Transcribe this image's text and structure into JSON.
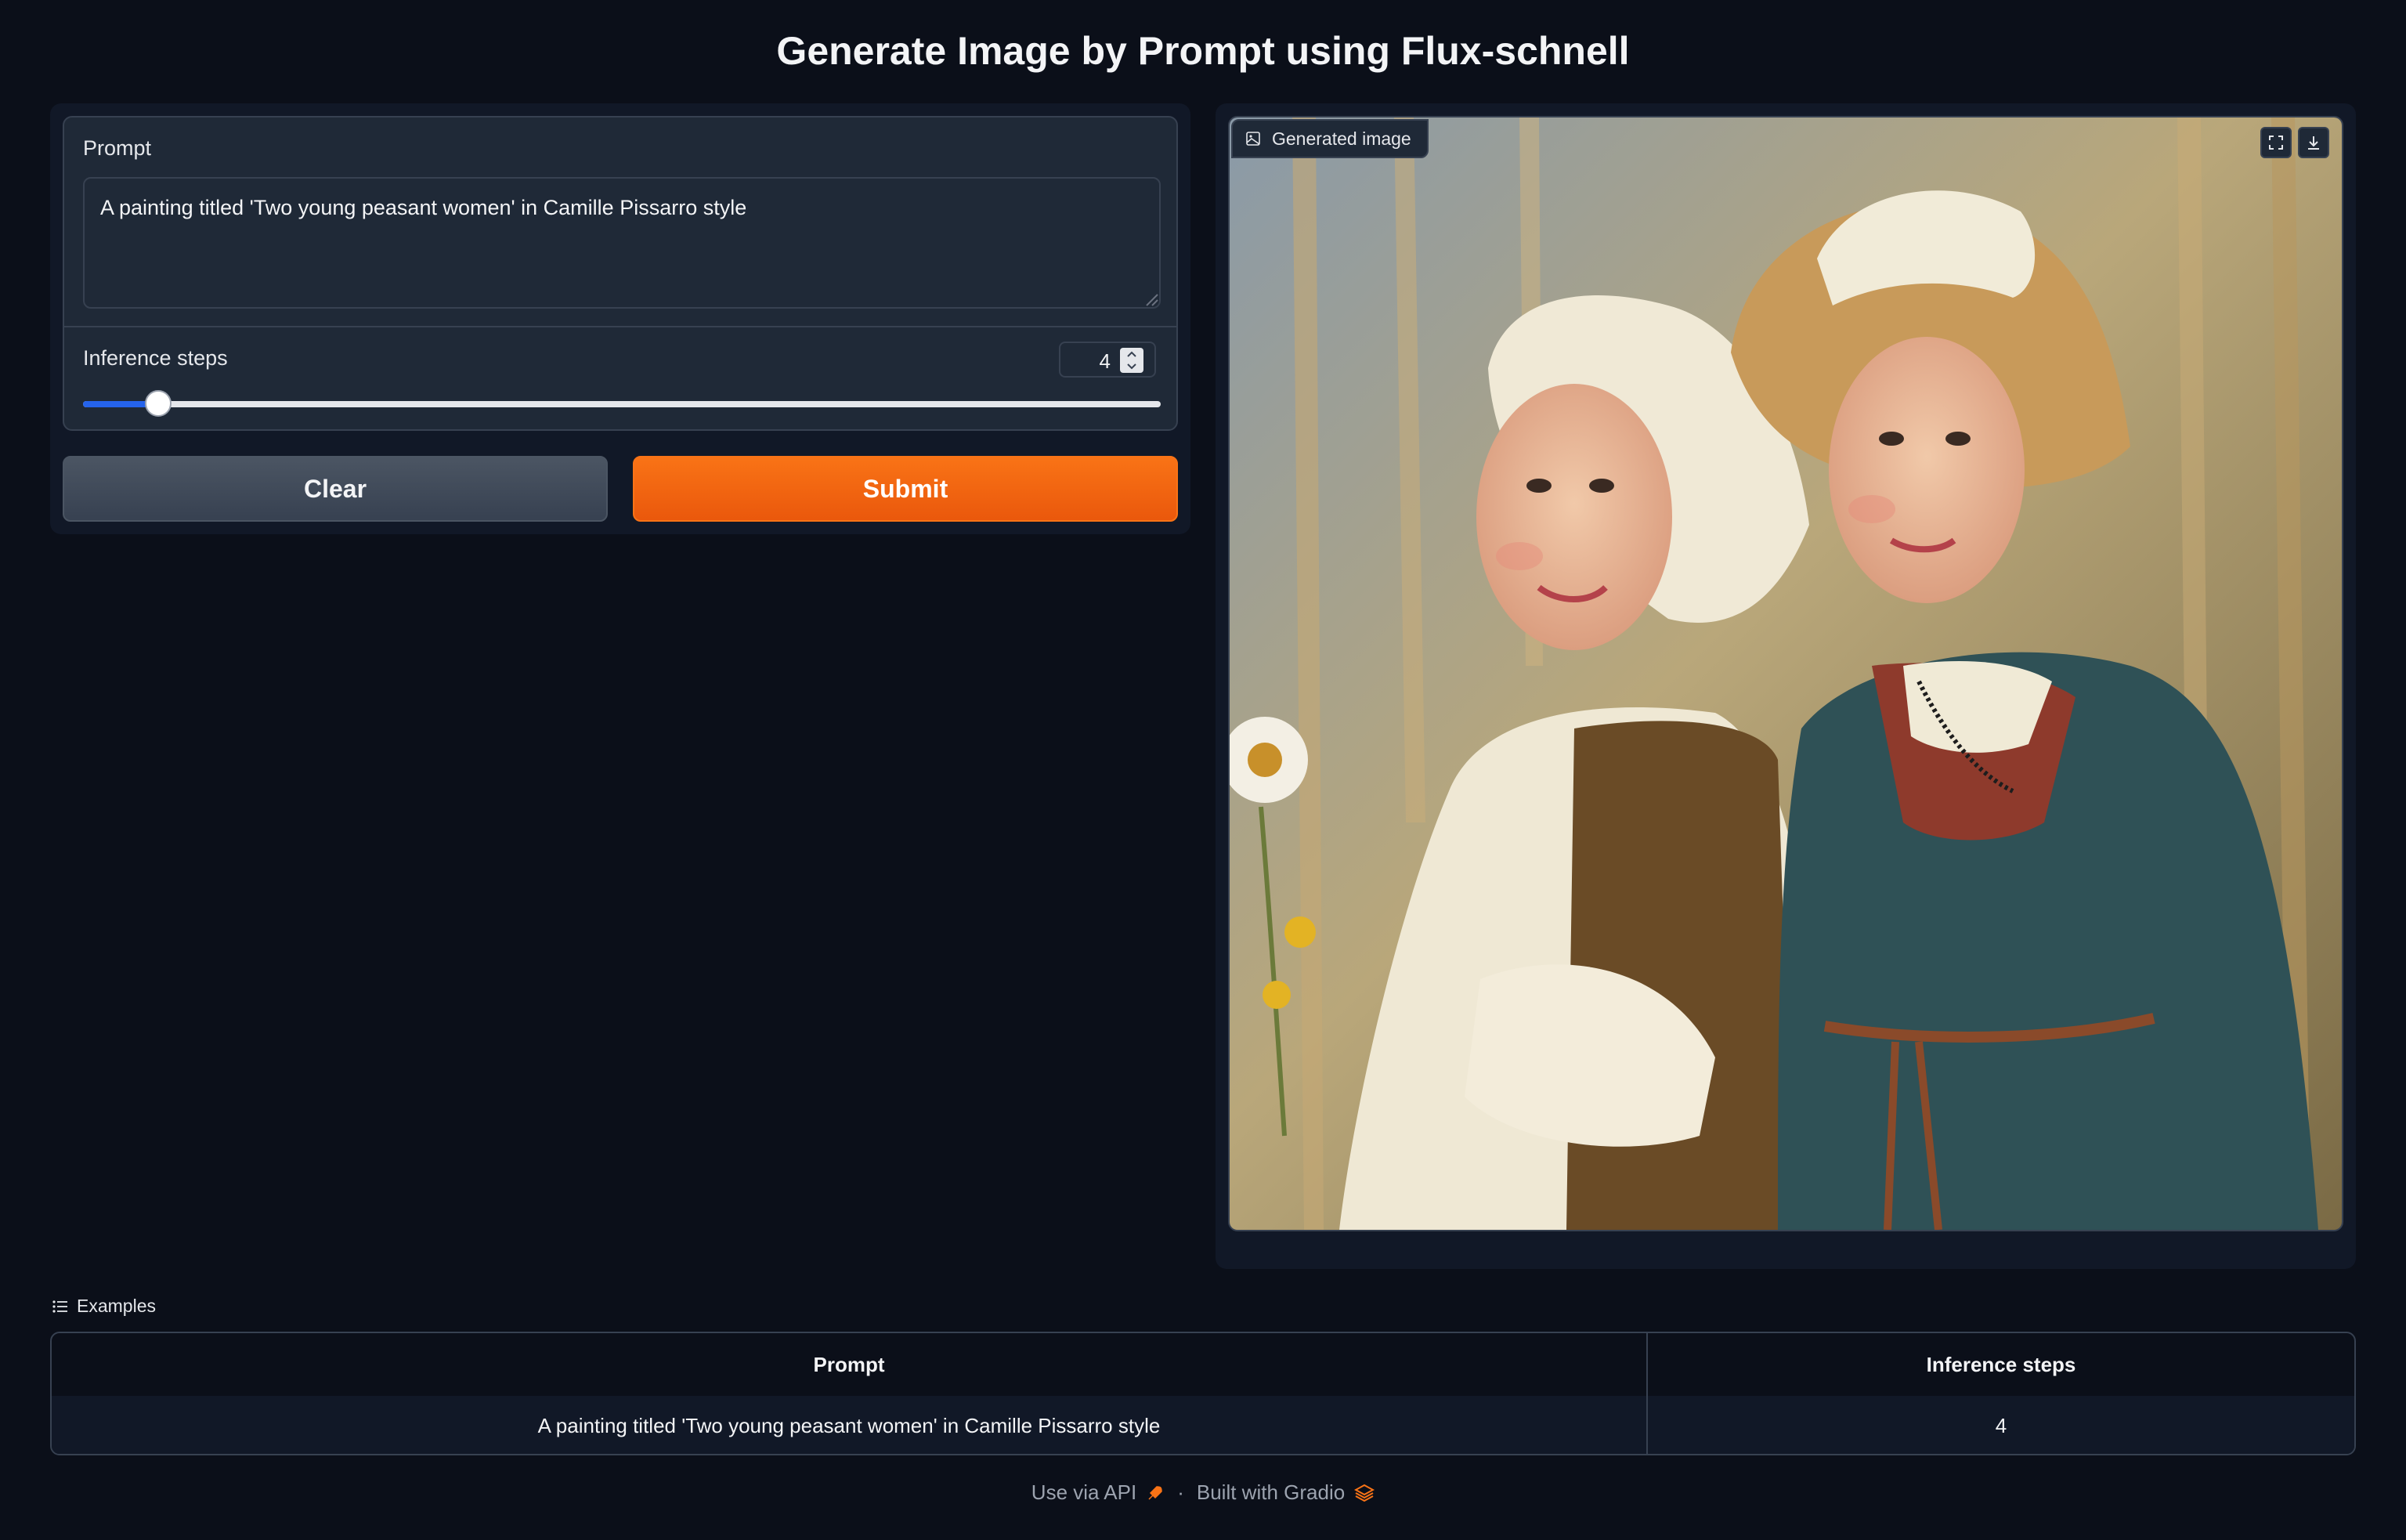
{
  "app": {
    "title": "Generate Image by Prompt using Flux-schnell"
  },
  "inputs": {
    "prompt_label": "Prompt",
    "prompt_value": "A painting titled 'Two young peasant women' in Camille Pissarro style",
    "steps_label": "Inference steps",
    "steps_value": "4",
    "steps_slider_fraction": 0.07
  },
  "buttons": {
    "clear_label": "Clear",
    "submit_label": "Submit"
  },
  "output": {
    "badge_label": "Generated image",
    "badge_icon": "image-icon",
    "fullscreen_icon": "fullscreen-icon",
    "download_icon": "download-icon"
  },
  "examples": {
    "title": "Examples",
    "columns": [
      "Prompt",
      "Inference steps"
    ],
    "rows": [
      [
        "A painting titled 'Two young peasant women' in Camille Pissarro style",
        "4"
      ]
    ]
  },
  "footer": {
    "api_label": "Use via API",
    "separator": "·",
    "built_label": "Built with Gradio"
  },
  "colors": {
    "background": "#0b0f19",
    "panel": "#111827",
    "accent_orange": "#f97316",
    "slider_blue": "#2563eb"
  }
}
